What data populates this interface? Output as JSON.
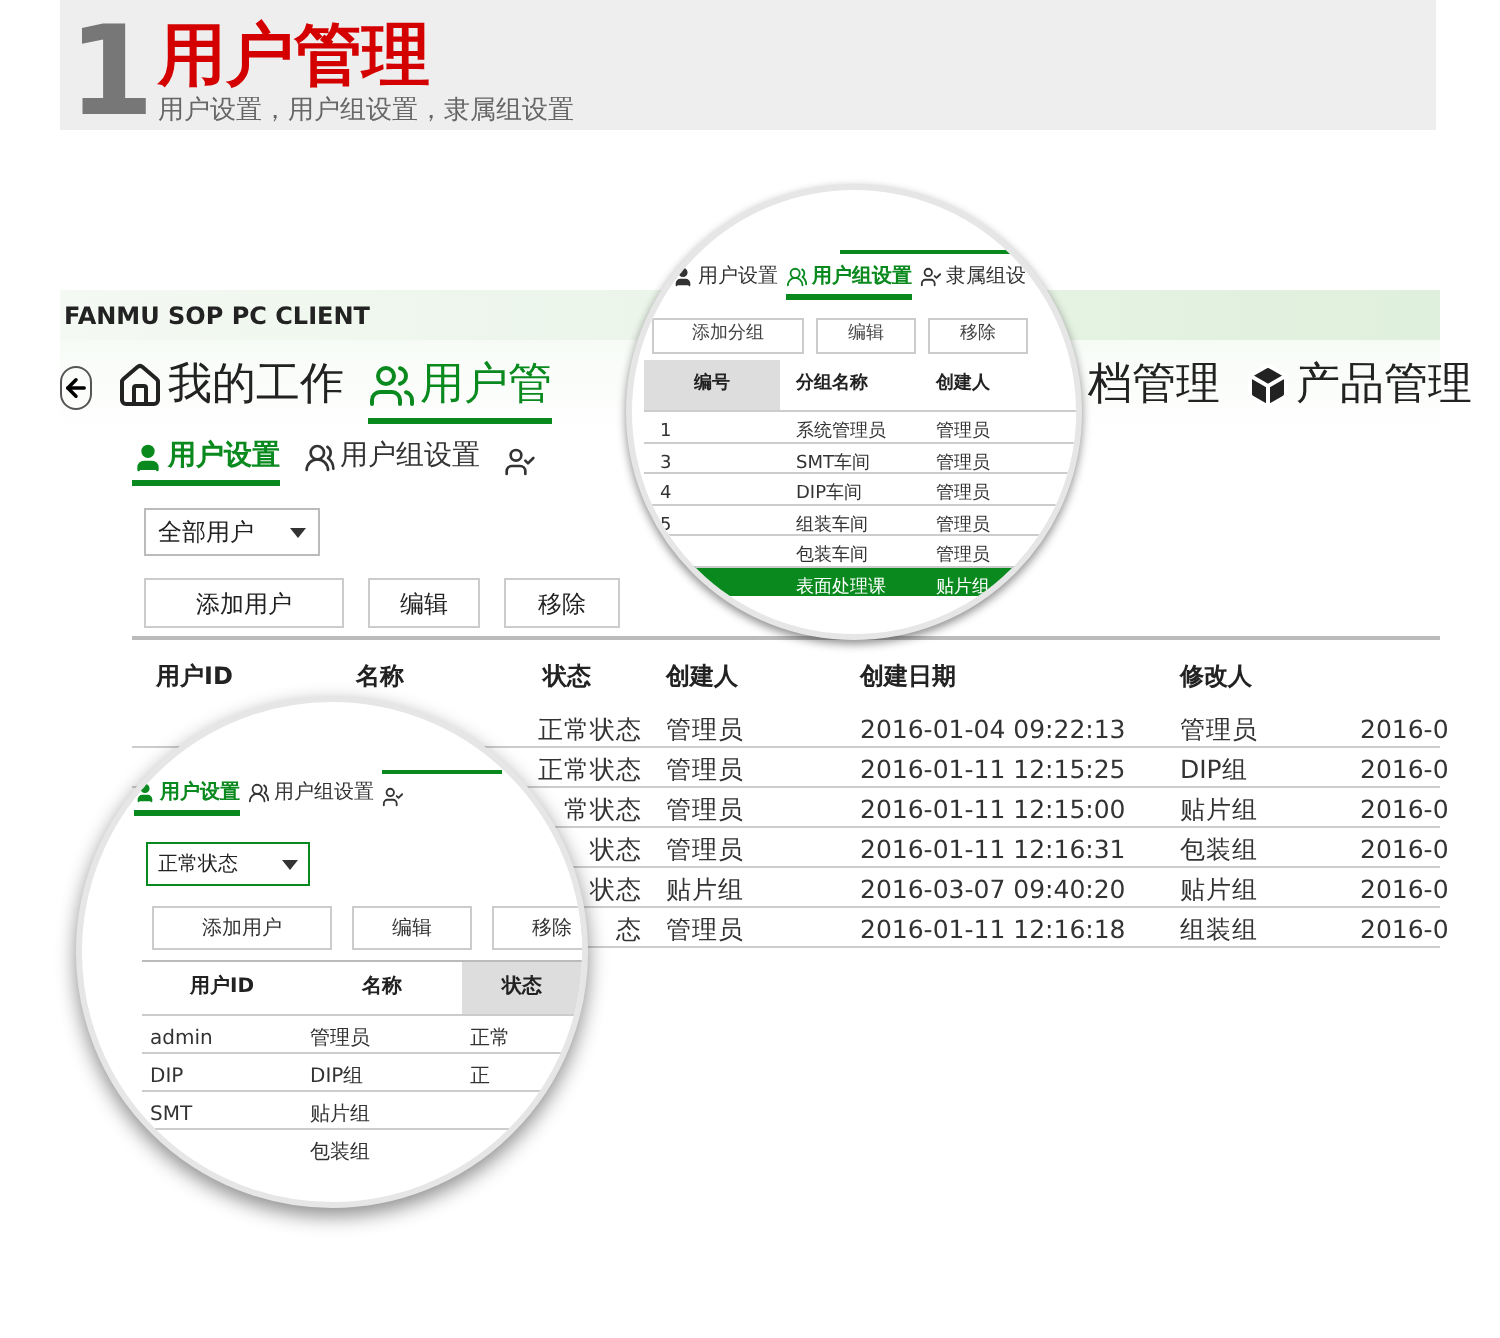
{
  "banner": {
    "number": "1",
    "title": "用户管理",
    "subtitle": "用户设置，用户组设置，隶属组设置"
  },
  "app": {
    "title": "FANMU SOP PC CLIENT",
    "nav": [
      {
        "label": "我的工作",
        "selected": false
      },
      {
        "label": "用户管",
        "selected": true
      },
      {
        "label": "档管理",
        "selected": false
      },
      {
        "label": "产品管理",
        "selected": false
      }
    ],
    "subtabs": [
      {
        "label": "用户设置",
        "selected": true
      },
      {
        "label": "用户组设置",
        "selected": false
      },
      {
        "selected": false
      }
    ],
    "filter": {
      "value": "全部用户"
    },
    "buttons": [
      "添加用户",
      "编辑",
      "移除"
    ],
    "table": {
      "columns": [
        "用户ID",
        "名称",
        "状态",
        "创建人",
        "创建日期",
        "修改人",
        ""
      ],
      "rows": [
        [
          "",
          "",
          "正常状态",
          "管理员",
          "2016-01-04 09:22:13",
          "管理员",
          "2016-0"
        ],
        [
          "",
          "",
          "正常状态",
          "管理员",
          "2016-01-11 12:15:25",
          "DIP组",
          "2016-0"
        ],
        [
          "",
          "",
          "常状态",
          "管理员",
          "2016-01-11 12:15:00",
          "贴片组",
          "2016-0"
        ],
        [
          "",
          "",
          "状态",
          "管理员",
          "2016-01-11 12:16:31",
          "包装组",
          "2016-0"
        ],
        [
          "",
          "",
          "状态",
          "贴片组",
          "2016-03-07 09:40:20",
          "贴片组",
          "2016-0"
        ],
        [
          "",
          "",
          "态",
          "管理员",
          "2016-01-11 12:16:18",
          "组装组",
          "2016-0"
        ]
      ]
    }
  },
  "zoom_groups": {
    "tabs": [
      {
        "label": "用户设置",
        "selected": false
      },
      {
        "label": "用户组设置",
        "selected": true
      },
      {
        "label": "隶属组设",
        "selected": false
      }
    ],
    "buttons": [
      "添加分组",
      "编辑",
      "移除"
    ],
    "columns": [
      "编号",
      "分组名称",
      "创建人"
    ],
    "rows": [
      {
        "cells": [
          "1",
          "系统管理员",
          "管理员"
        ],
        "selected": false
      },
      {
        "cells": [
          "3",
          "SMT车间",
          "管理员"
        ],
        "selected": false
      },
      {
        "cells": [
          "4",
          "DIP车间",
          "管理员"
        ],
        "selected": false
      },
      {
        "cells": [
          "5",
          "组装车间",
          "管理员"
        ],
        "selected": false
      },
      {
        "cells": [
          "",
          "包装车间",
          "管理员"
        ],
        "selected": false
      },
      {
        "cells": [
          "",
          "表面处理课",
          "贴片组"
        ],
        "selected": true
      }
    ]
  },
  "zoom_users": {
    "tabs": [
      {
        "label": "用户设置",
        "selected": true
      },
      {
        "label": "用户组设置",
        "selected": false
      },
      {
        "selected": false
      }
    ],
    "filter": {
      "value": "正常状态"
    },
    "buttons": [
      "添加用户",
      "编辑",
      "移除"
    ],
    "columns": [
      "用户ID",
      "名称",
      "状态"
    ],
    "rows": [
      [
        "admin",
        "管理员",
        "正常"
      ],
      [
        "DIP",
        "DIP组",
        "正"
      ],
      [
        "SMT",
        "贴片组",
        ""
      ],
      [
        "",
        "包装组",
        ""
      ]
    ]
  }
}
